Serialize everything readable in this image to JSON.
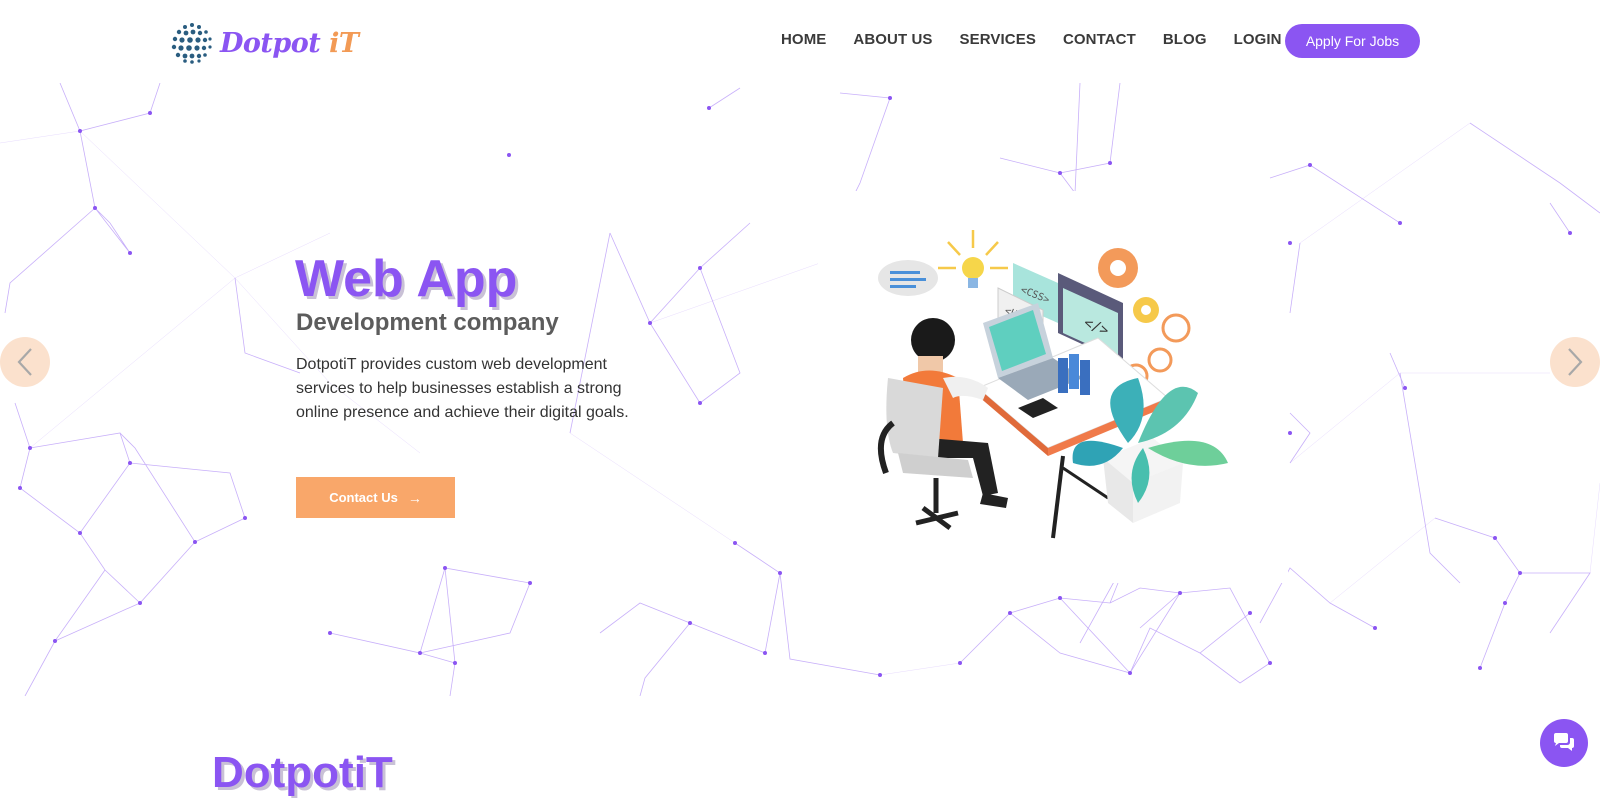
{
  "header": {
    "logo": {
      "part1": "Dotpot ",
      "part2": "iT"
    },
    "nav": [
      "HOME",
      "ABOUT US",
      "SERVICES",
      "CONTACT",
      "BLOG",
      "LOGIN"
    ],
    "apply_label": "Apply For Jobs"
  },
  "hero": {
    "title": "Web App",
    "subtitle": "Development company",
    "description": "DotpotiT provides custom web development services to help businesses establish a strong online presence and achieve their digital goals.",
    "cta_label": "Contact Us",
    "cta_arrow": "→",
    "illustration_labels": {
      "css": "<CSS>",
      "html": "<HTML>",
      "code": "</>"
    }
  },
  "section": {
    "title": "DotpotiT"
  },
  "colors": {
    "brand": "#8b55f2",
    "accent": "#f29a55",
    "cta": "#f9a76a"
  },
  "icons": {
    "prev": "chevron-left-icon",
    "next": "chevron-right-icon",
    "chat": "chat-icon"
  }
}
